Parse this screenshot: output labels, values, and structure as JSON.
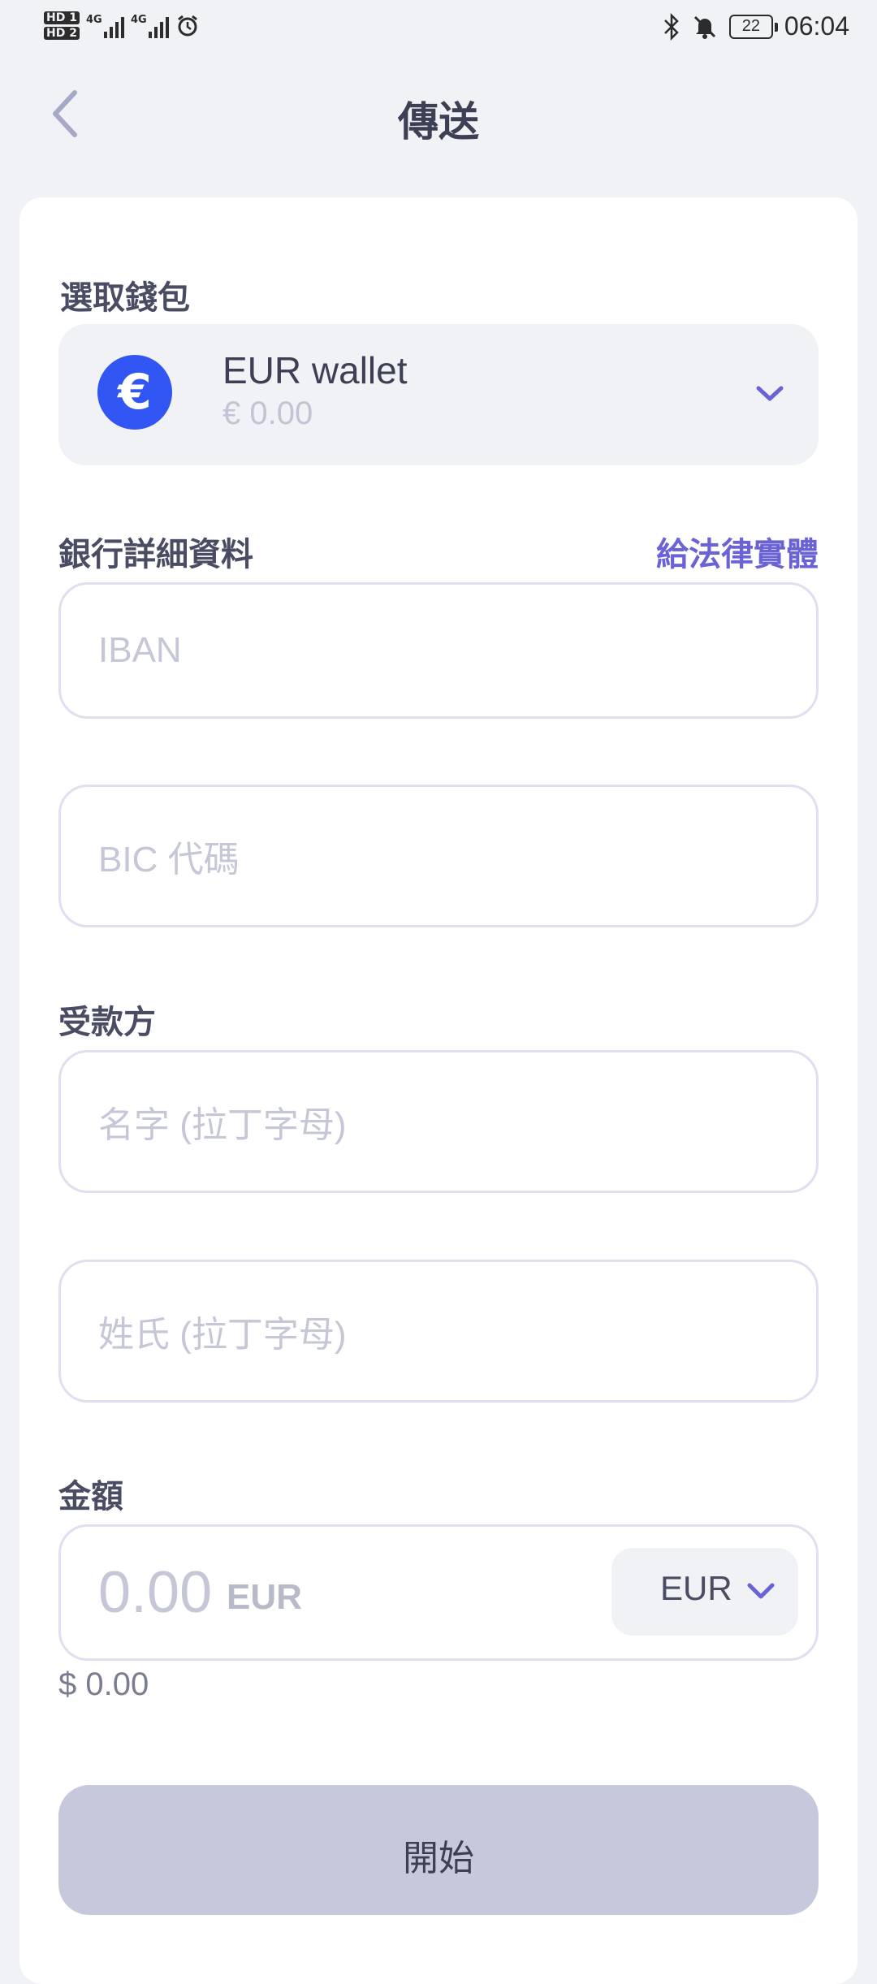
{
  "status_bar": {
    "hd1": "HD 1",
    "hd2": "HD 2",
    "net1": "4G",
    "net2": "4G",
    "battery": "22",
    "time": "06:04"
  },
  "header": {
    "title": "傳送",
    "back_icon": "chevron-left-icon"
  },
  "wallet_section": {
    "label": "選取錢包",
    "wallet_icon_symbol": "€",
    "wallet_name": "EUR wallet",
    "wallet_balance": "€ 0.00",
    "expand_icon": "chevron-down-icon"
  },
  "bank_section": {
    "label": "銀行詳細資料",
    "legal_entity_link": "給法律實體",
    "iban_placeholder": "IBAN",
    "bic_placeholder": "BIC 代碼"
  },
  "recipient_section": {
    "label": "受款方",
    "first_name_placeholder": "名字 (拉丁字母)",
    "last_name_placeholder": "姓氏 (拉丁字母)"
  },
  "amount_section": {
    "label": "金額",
    "amount_placeholder": "0.00",
    "amount_unit": "EUR",
    "currency_selected": "EUR",
    "fiat_equivalent": "$ 0.00"
  },
  "actions": {
    "start_label": "開始"
  },
  "colors": {
    "background": "#f1f2f5",
    "accent": "#6a63d6",
    "coin": "#3156f3",
    "button_disabled": "#c6c8dc"
  }
}
